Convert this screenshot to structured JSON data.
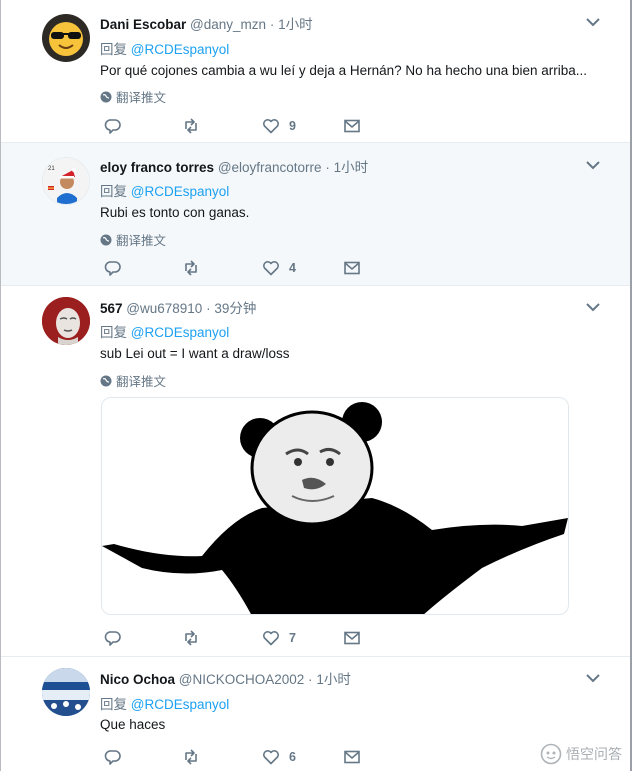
{
  "reply_prefix": "回复",
  "translate_label": "翻译推文",
  "tweets": [
    {
      "name": "Dani Escobar",
      "handle": "@dany_mzn",
      "separator": "·",
      "time": "1小时",
      "mention": "@RCDEspanyol",
      "text": "Por qué cojones cambia a wu leí y deja a Hernán? No ha hecho una bien arriba...",
      "likes": "9",
      "avatar": "sunglasses-emoji"
    },
    {
      "name": "eloy franco torres",
      "handle": "@eloyfrancotorre",
      "separator": "·",
      "time": "1小时",
      "mention": "@RCDEspanyol",
      "text": "Rubi es tonto con ganas.",
      "likes": "4",
      "avatar": "player-santa-hat"
    },
    {
      "name": "567",
      "handle": "@wu678910",
      "separator": "·",
      "time": "39分钟",
      "mention": "@RCDEspanyol",
      "text": "sub Lei out = I want a draw/loss",
      "likes": "7",
      "avatar": "face-portrait",
      "media": "panda-shrug-meme"
    },
    {
      "name": "Nico Ochoa",
      "handle": "@NICKOCHOA2002",
      "separator": "·",
      "time": "1小时",
      "mention": "@RCDEspanyol",
      "text": "Que haces",
      "likes": "6",
      "avatar": "stadium-crowd"
    }
  ],
  "watermark": {
    "text": "悟空问答",
    "icon": "wukong-icon"
  },
  "colors": {
    "accent": "#1da1f2",
    "muted": "#657786",
    "highlight_bg": "#f5f8fa"
  }
}
